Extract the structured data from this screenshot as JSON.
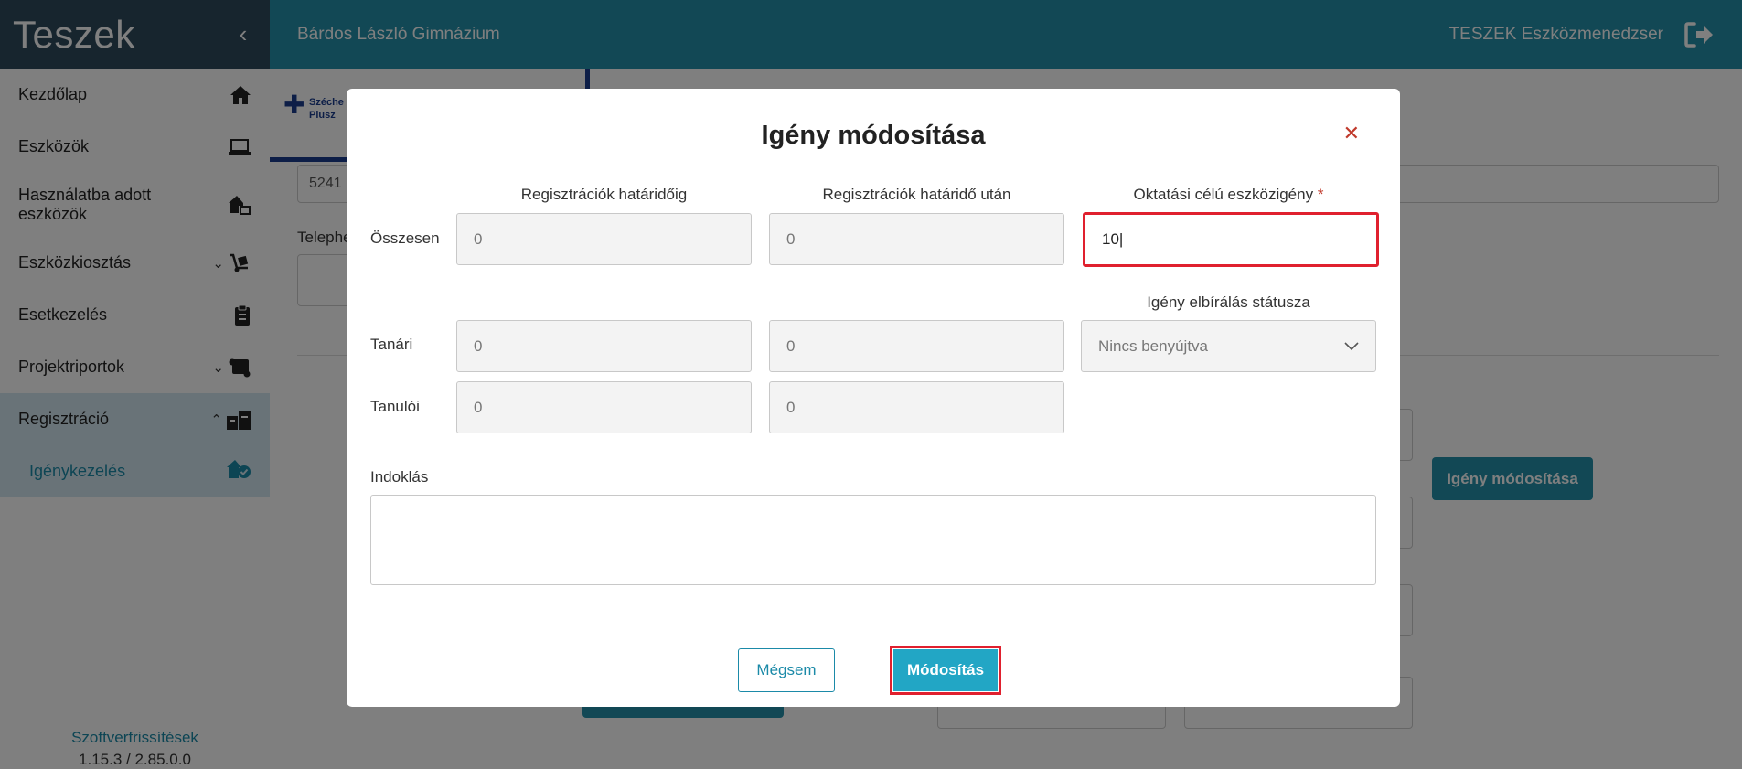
{
  "sidebar": {
    "brand": "Teszek",
    "items": [
      {
        "label": "Kezdőlap",
        "icon": "home-icon"
      },
      {
        "label": "Eszközök",
        "icon": "laptop-icon"
      },
      {
        "label": "Használatba adott eszközök",
        "icon": "house-device-icon"
      },
      {
        "label": "Eszközkiosztás",
        "icon": "dolly-icon"
      },
      {
        "label": "Esetkezelés",
        "icon": "clipboard-icon"
      },
      {
        "label": "Projektriportok",
        "icon": "scroll-icon"
      },
      {
        "label": "Regisztráció",
        "icon": "registration-icon"
      }
    ],
    "subitem": {
      "label": "Igénykezelés",
      "icon": "request-icon"
    },
    "footer": {
      "link": "Szoftverfrissítések",
      "version": "1.15.3 / 2.85.0.0"
    }
  },
  "topbar": {
    "school": "Bárdos László Gimnázium",
    "app": "TESZEK Eszközmenedzser"
  },
  "background": {
    "logo_line1": "Széche",
    "logo_line2": "Plusz",
    "field1": "5241",
    "label_site": "Telephe",
    "button_label": "Igény módosítása"
  },
  "modal": {
    "title": "Igény módosítása",
    "col1": "Regisztrációk határidőig",
    "col2": "Regisztrációk határidő után",
    "col3": "Oktatási célú eszközigény",
    "col3_required": "*",
    "status_label": "Igény elbírálás státusza",
    "rows": {
      "total": {
        "label": "Összesen",
        "v1": "0",
        "v2": "0",
        "v3": "10"
      },
      "teacher": {
        "label": "Tanári",
        "v1": "0",
        "v2": "0"
      },
      "student": {
        "label": "Tanulói",
        "v1": "0",
        "v2": "0"
      }
    },
    "status_value": "Nincs benyújtva",
    "reason_label": "Indoklás",
    "reason_value": "",
    "cancel_label": "Mégsem",
    "submit_label": "Módosítás"
  },
  "colors": {
    "sidebar_header": "#2e4a5c",
    "topbar": "#2491aa",
    "accent": "#1b8aa8",
    "highlight": "#e0202e"
  }
}
